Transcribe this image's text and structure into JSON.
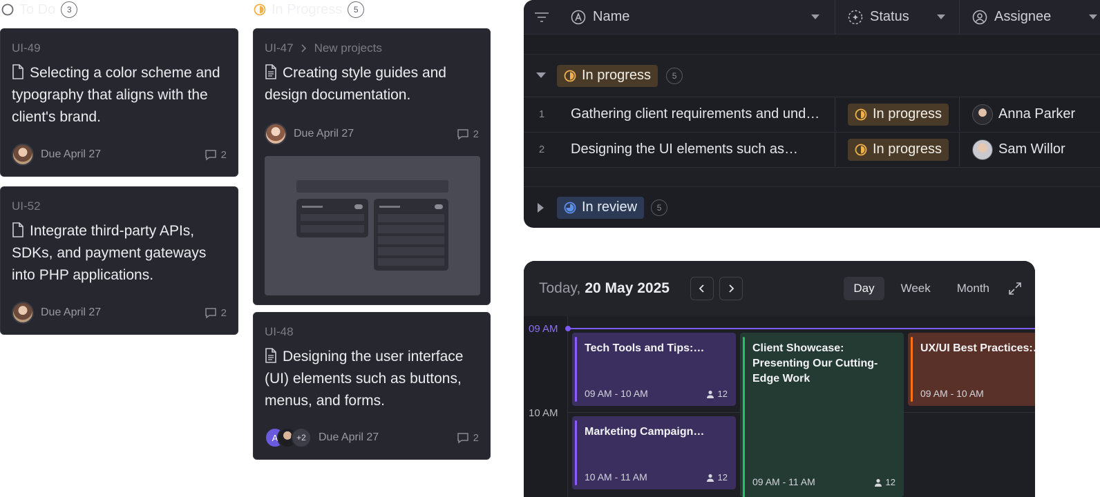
{
  "board": {
    "columns": [
      {
        "title": "To Do",
        "count": "3",
        "cards": [
          {
            "id": "UI-49",
            "title": "Selecting a color scheme and typography that aligns with the client's brand.",
            "due": "Due April 27",
            "comments": "2"
          },
          {
            "id": "UI-52",
            "title": "Integrate third-party APIs, SDKs, and payment gateways into PHP applications.",
            "due": "Due April 27",
            "comments": "2"
          }
        ]
      },
      {
        "title": "In Progress",
        "count": "5",
        "cards": [
          {
            "id": "UI-47",
            "project": "New projects",
            "title": "Creating style guides and design documentation.",
            "due": "Due April 27",
            "comments": "2"
          },
          {
            "id": "UI-48",
            "title": "Designing the user interface (UI) elements such as buttons, menus, and forms.",
            "due": "Due April 27",
            "comments": "2",
            "extra_assignees": "+2",
            "avatar_letter": "A"
          }
        ]
      }
    ]
  },
  "table": {
    "columns": {
      "name": "Name",
      "status": "Status",
      "assignee": "Assignee"
    },
    "groups": [
      {
        "status": "In progress",
        "count": "5",
        "rows": [
          {
            "num": "1",
            "name": "Gathering client requirements and und…",
            "status": "In progress",
            "assignee": "Anna Parker"
          },
          {
            "num": "2",
            "name": "Designing the UI elements such as…",
            "status": "In progress",
            "assignee": "Sam Willor"
          }
        ]
      },
      {
        "status": "In review",
        "count": "5"
      }
    ]
  },
  "calendar": {
    "today_label": "Today,",
    "date": "20 May 2025",
    "views": [
      "Day",
      "Week",
      "Month"
    ],
    "active_view": "Day",
    "time_labels": [
      "09 AM",
      "10 AM"
    ],
    "events": [
      {
        "title": "Tech Tools and Tips:…",
        "time": "09 AM - 10 AM",
        "attendees": "12",
        "color": "#8b5cf6"
      },
      {
        "title": "Client Showcase: Presenting Our Cutting-Edge Work",
        "time": "09 AM - 11 AM",
        "attendees": "12",
        "color": "#22c55e"
      },
      {
        "title": "UX/UI Best Practices:…",
        "time": "09 AM - 10 AM",
        "attendees": "",
        "color": "#f97316"
      },
      {
        "title": "Marketing Campaign…",
        "time": "10 AM - 11 AM",
        "attendees": "12",
        "color": "#8b5cf6"
      }
    ]
  },
  "colors": {
    "in_progress": "#f0b04a",
    "in_review": "#5b8ff0",
    "now_line": "#7c5cf0"
  }
}
